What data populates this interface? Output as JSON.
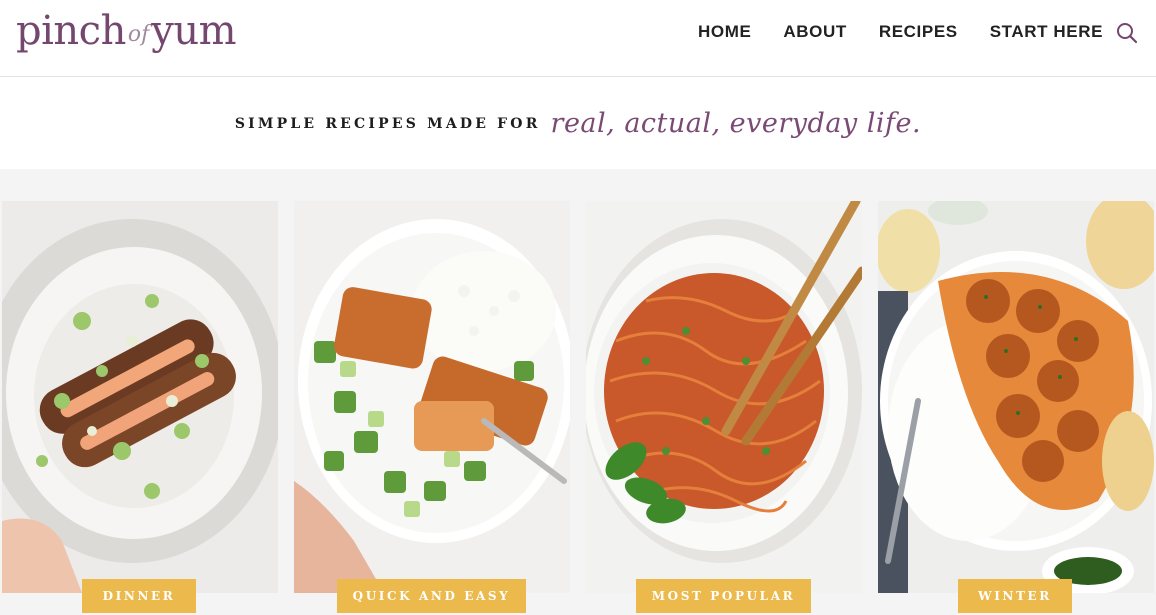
{
  "logo": {
    "word1": "pinch",
    "word2": "of",
    "word3": "yum"
  },
  "nav": {
    "items": [
      "HOME",
      "ABOUT",
      "RECIPES",
      "START HERE"
    ]
  },
  "icons": {
    "search": "search-icon"
  },
  "tagline": {
    "caps": "SIMPLE RECIPES MADE FOR",
    "script": "real, actual, everyday life."
  },
  "cards": [
    {
      "label": "DINNER",
      "image": "tacos-plate-photo"
    },
    {
      "label": "QUICK AND EASY",
      "image": "salmon-bowl-photo"
    },
    {
      "label": "MOST POPULAR",
      "image": "noodles-bowl-photo"
    },
    {
      "label": "WINTER",
      "image": "meatballs-curry-photo"
    }
  ],
  "colors": {
    "brand": "#74476f",
    "badge": "#ecb94d",
    "bg": "#f4f4f4"
  }
}
